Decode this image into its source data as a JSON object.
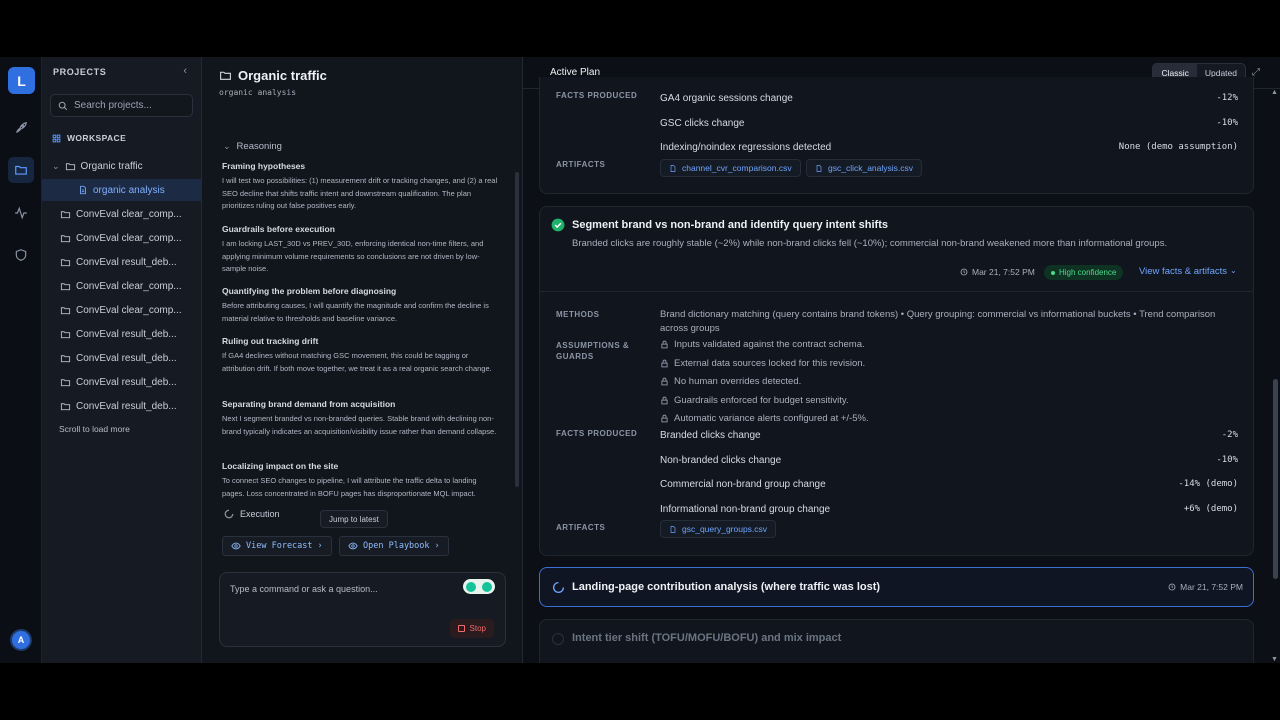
{
  "rail": {
    "logo": "L",
    "avatar": "A"
  },
  "projects": {
    "header": "PROJECTS",
    "search_placeholder": "Search projects...",
    "workspace_label": "WORKSPACE",
    "tree": [
      {
        "label": "Organic traffic"
      },
      {
        "label": "organic analysis"
      },
      {
        "label": "ConvEval clear_comp..."
      },
      {
        "label": "ConvEval clear_comp..."
      },
      {
        "label": "ConvEval result_deb..."
      },
      {
        "label": "ConvEval clear_comp..."
      },
      {
        "label": "ConvEval clear_comp..."
      },
      {
        "label": "ConvEval result_deb..."
      },
      {
        "label": "ConvEval result_deb..."
      },
      {
        "label": "ConvEval result_deb..."
      },
      {
        "label": "ConvEval result_deb..."
      }
    ],
    "scroll_more": "Scroll to load more"
  },
  "chat": {
    "title": "Organic traffic",
    "subtitle": "organic analysis",
    "reasoning_label": "Reasoning",
    "steps": [
      {
        "title": "Framing hypotheses",
        "body": "I will test two possibilities: (1) measurement drift or tracking changes, and (2) a real SEO decline that shifts traffic intent and downstream qualification. The plan prioritizes ruling out false positives early."
      },
      {
        "title": "Guardrails before execution",
        "body": "I am locking LAST_30D vs PREV_30D, enforcing identical non-time filters, and applying minimum volume requirements so conclusions are not driven by low-sample noise."
      },
      {
        "title": "Quantifying the problem before diagnosing",
        "body": "Before attributing causes, I will quantify the magnitude and confirm the decline is material relative to thresholds and baseline variance."
      },
      {
        "title": "Ruling out tracking drift",
        "body": "If GA4 declines without matching GSC movement, this could be tagging or attribution drift. If both move together, we treat it as a real organic search change."
      },
      {
        "title": "Separating brand demand from acquisition",
        "body": "Next I segment branded vs non-branded queries. Stable brand with declining non-brand typically indicates an acquisition/visibility issue rather than demand collapse."
      },
      {
        "title": "Localizing impact on the site",
        "body": "To connect SEO changes to pipeline, I will attribute the traffic delta to landing pages. Loss concentrated in BOFU pages has disproportionate MQL impact."
      }
    ],
    "execution_label": "Execution",
    "jump_label": "Jump to latest",
    "forecast_label": "View Forecast",
    "playbook_label": "Open Playbook",
    "composer_placeholder": "Type a command or ask a question...",
    "stop_label": "Stop"
  },
  "plan": {
    "tab": "Active Plan",
    "toggle": {
      "classic": "Classic",
      "updated": "Updated"
    },
    "card1": {
      "facts_label": "FACTS PRODUCED",
      "facts": [
        {
          "name": "GA4 organic sessions change",
          "value": "-12%"
        },
        {
          "name": "GSC clicks change",
          "value": "-10%"
        },
        {
          "name": "Indexing/noindex regressions detected",
          "value": "None (demo assumption)"
        }
      ],
      "artifacts_label": "ARTIFACTS",
      "artifacts": [
        "channel_cvr_comparison.csv",
        "gsc_click_analysis.csv"
      ]
    },
    "card2": {
      "title": "Segment brand vs non-brand and identify query intent shifts",
      "summary": "Branded clicks are roughly stable (~2%) while non-brand clicks fell (~10%); commercial non-brand weakened more than informational groups.",
      "timestamp": "Mar 21, 7:52 PM",
      "confidence": "High confidence",
      "facts_link": "View facts & artifacts",
      "methods_label": "METHODS",
      "methods": "Brand dictionary matching (query contains brand tokens) • Query grouping: commercial vs informational buckets • Trend comparison across groups",
      "assumptions_label": "ASSUMPTIONS & GUARDS",
      "guards": [
        "Inputs validated against the contract schema.",
        "External data sources locked for this revision.",
        "No human overrides detected.",
        "Guardrails enforced for budget sensitivity.",
        "Automatic variance alerts configured at +/-5%."
      ],
      "facts_label": "FACTS PRODUCED",
      "facts": [
        {
          "name": "Branded clicks change",
          "value": "-2%"
        },
        {
          "name": "Non-branded clicks change",
          "value": "-10%"
        },
        {
          "name": "Commercial non-brand group change",
          "value": "-14% (demo)"
        },
        {
          "name": "Informational non-brand group change",
          "value": "+6% (demo)"
        }
      ],
      "artifacts_label": "ARTIFACTS",
      "artifacts": [
        "gsc_query_groups.csv"
      ]
    },
    "card3": {
      "title": "Landing-page contribution analysis (where traffic was lost)",
      "timestamp": "Mar 21, 7:52 PM"
    },
    "card4": {
      "title": "Intent tier shift (TOFU/MOFU/BOFU) and mix impact"
    }
  }
}
